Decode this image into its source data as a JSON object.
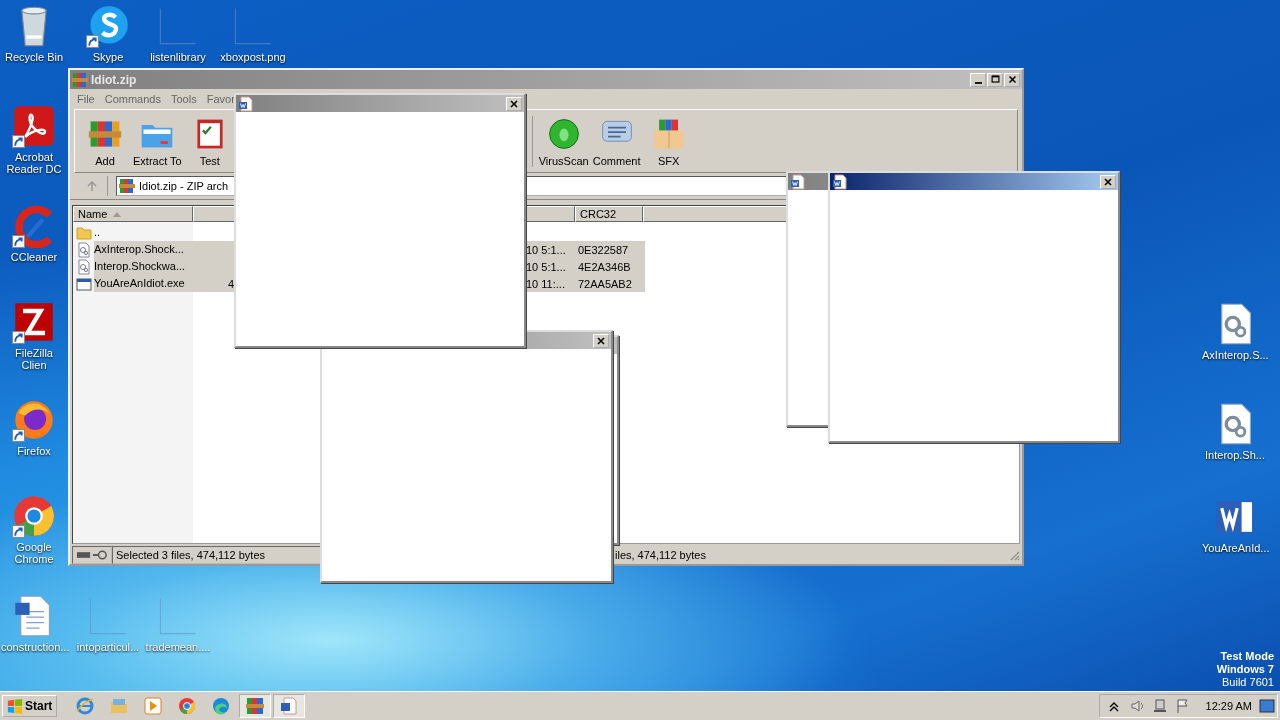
{
  "desktop_icons": [
    {
      "label": "Recycle Bin",
      "kind": "recycle",
      "shortcut": false
    },
    {
      "label": "Skype",
      "kind": "skype",
      "shortcut": true
    },
    {
      "label": "listenlibrary",
      "kind": "blank",
      "shortcut": false
    },
    {
      "label": "xboxpost.png",
      "kind": "blank",
      "shortcut": false
    },
    {
      "label": "Acrobat Reader DC",
      "kind": "acrobat",
      "shortcut": true
    },
    {
      "label": "CCleaner",
      "kind": "ccleaner",
      "shortcut": true
    },
    {
      "label": "FileZilla Clien",
      "kind": "filezilla",
      "shortcut": true
    },
    {
      "label": "Firefox",
      "kind": "firefox",
      "shortcut": true
    },
    {
      "label": "Google Chrome",
      "kind": "chrome",
      "shortcut": true
    },
    {
      "label": "construction...",
      "kind": "worddoc",
      "shortcut": false
    },
    {
      "label": "intoparticul...",
      "kind": "blank",
      "shortcut": false
    },
    {
      "label": "trademean....",
      "kind": "blank",
      "shortcut": false
    },
    {
      "label": "AxInterop.S...",
      "kind": "config",
      "shortcut": false
    },
    {
      "label": "Interop.Sh...",
      "kind": "config",
      "shortcut": false
    },
    {
      "label": "YouAreAnId...",
      "kind": "wordapp",
      "shortcut": false
    }
  ],
  "winrar": {
    "title": "Idiot.zip",
    "menu": [
      "File",
      "Commands",
      "Tools",
      "Favor"
    ],
    "toolbar": [
      {
        "label": "Add",
        "kind": "add"
      },
      {
        "label": "Extract To",
        "kind": "extract"
      },
      {
        "label": "Test",
        "kind": "test"
      },
      {
        "label": "VirusScan",
        "kind": "virusscan"
      },
      {
        "label": "Comment",
        "kind": "comment"
      },
      {
        "label": "SFX",
        "kind": "sfx"
      }
    ],
    "address": "Idiot.zip - ZIP arch",
    "columns": [
      {
        "label": "Name",
        "sorted": true
      },
      {
        "label": "CRC32",
        "sorted": false
      }
    ],
    "rows": [
      {
        "name": "..",
        "kind": "folder",
        "selected": false
      },
      {
        "name": "AxInterop.Shock...",
        "kind": "config",
        "selected": true,
        "modified": "10 5:1...",
        "crc": "0E322587"
      },
      {
        "name": "Interop.Shockwa...",
        "kind": "config",
        "selected": true,
        "modified": "10 5:1...",
        "crc": "4E2A346B"
      },
      {
        "name": "YouAreAnIdiot.exe",
        "kind": "exe",
        "selected": true,
        "size": "4",
        "modified": "10 11:...",
        "crc": "72AA5AB2"
      }
    ],
    "status_left": "Selected 3 files, 474,112 bytes",
    "status_right": "iles, 474,112 bytes"
  },
  "dialogs": [
    {
      "active": false
    },
    {
      "active": false
    },
    {
      "active": false
    },
    {
      "active": false
    },
    {
      "active": true
    }
  ],
  "system_text": [
    "Test Mode",
    "Windows 7",
    "Build 7601"
  ],
  "taskbar": {
    "start": "Start",
    "apps": [
      {
        "kind": "ie",
        "pressed": false
      },
      {
        "kind": "explorer",
        "pressed": false
      },
      {
        "kind": "media",
        "pressed": false
      },
      {
        "kind": "chrome",
        "pressed": false
      },
      {
        "kind": "edge",
        "pressed": false
      },
      {
        "kind": "winrar",
        "pressed": true
      },
      {
        "kind": "word",
        "pressed": true
      }
    ],
    "time": "12:29 AM"
  }
}
